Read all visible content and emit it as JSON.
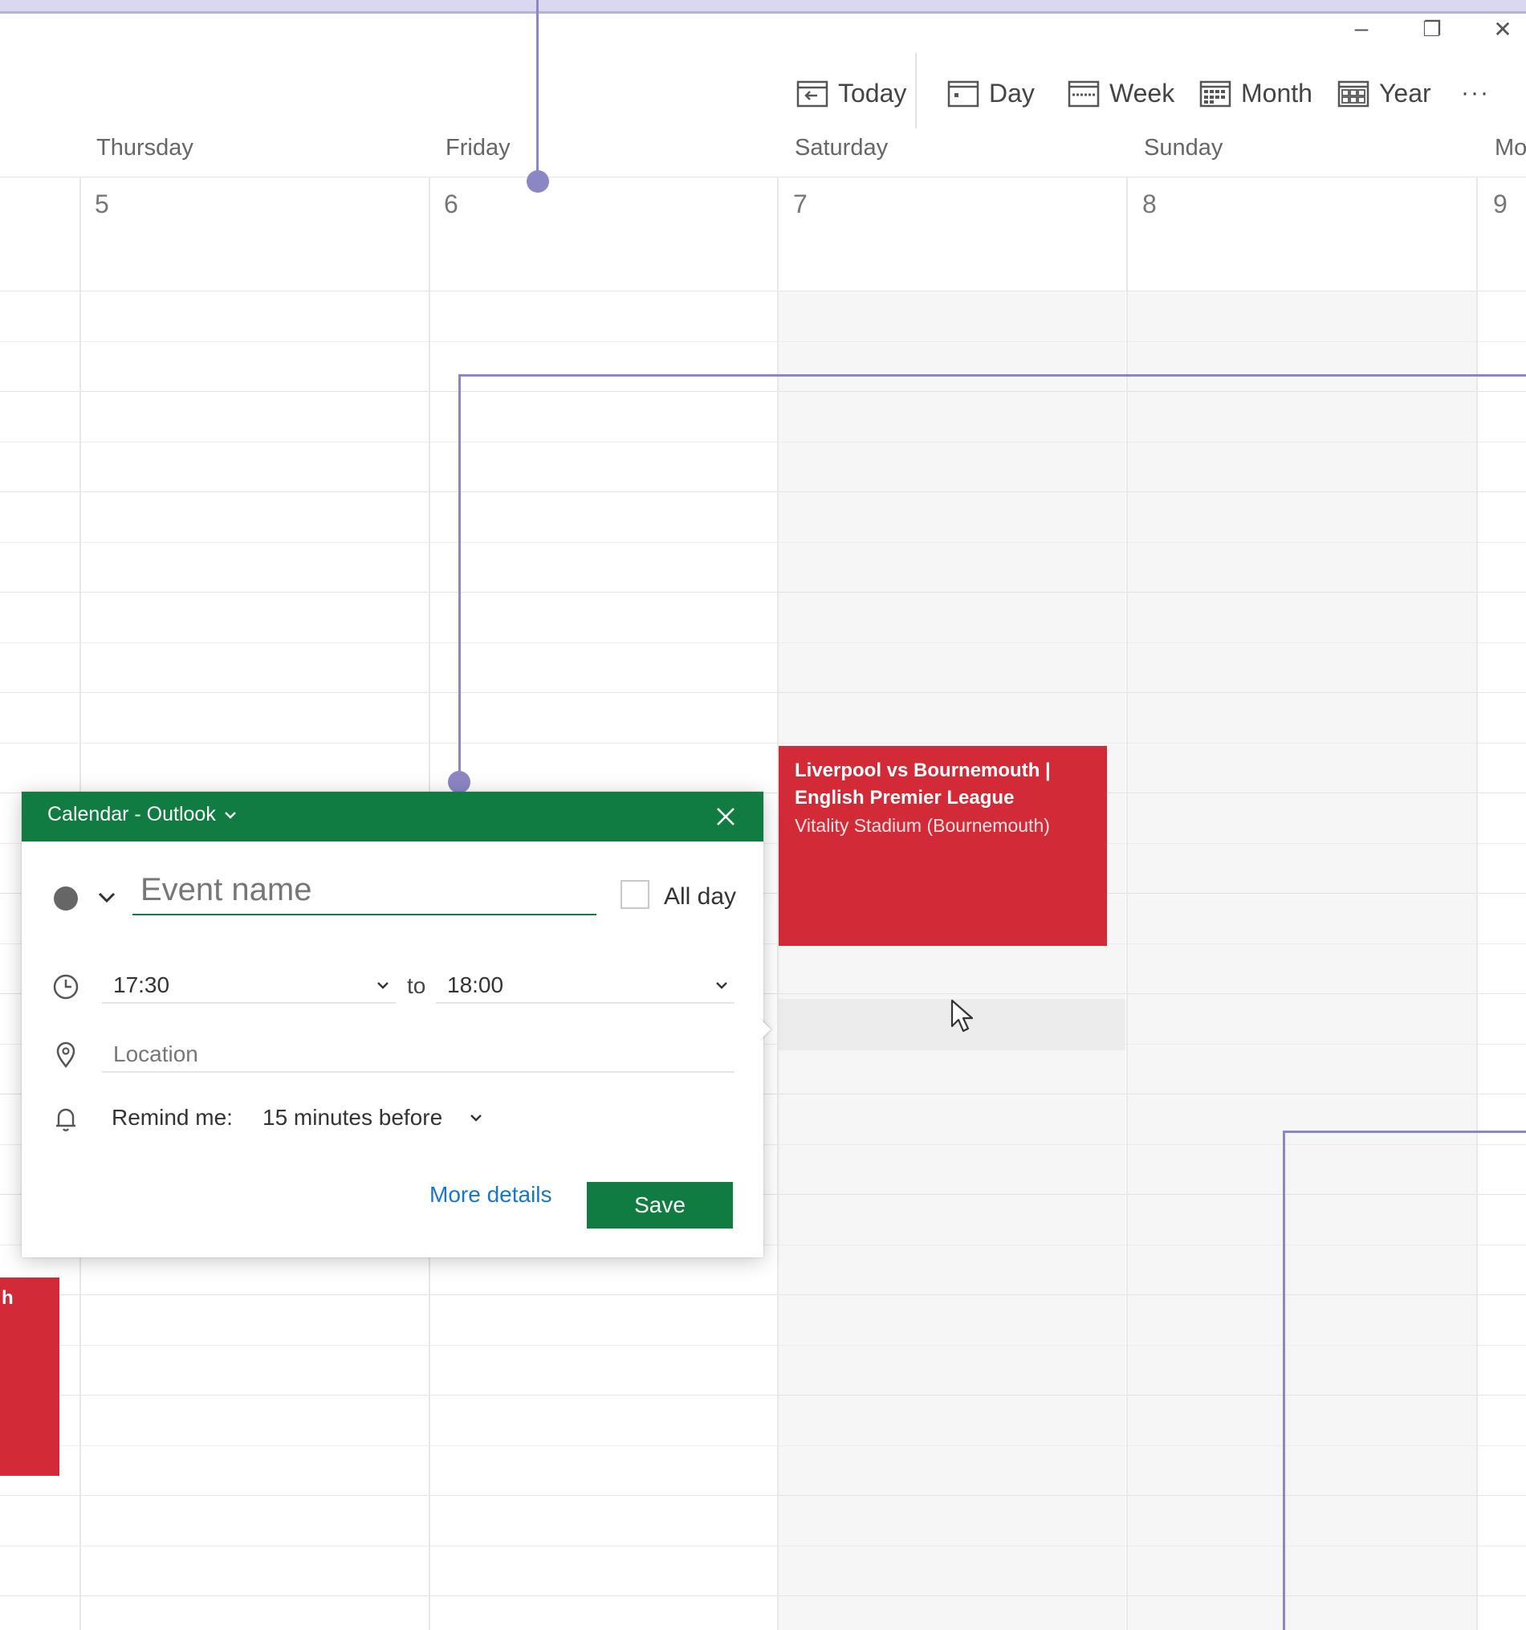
{
  "window": {
    "minimize_glyph": "–",
    "restore_glyph": "❐",
    "close_glyph": "✕"
  },
  "toolbar": {
    "today": "Today",
    "day": "Day",
    "week": "Week",
    "month": "Month",
    "year": "Year",
    "more": "···"
  },
  "days": [
    {
      "name": "Thursday",
      "number": "5"
    },
    {
      "name": "Friday",
      "number": "6"
    },
    {
      "name": "Saturday",
      "number": "7"
    },
    {
      "name": "Sunday",
      "number": "8"
    },
    {
      "name": "Mo",
      "number": "9"
    }
  ],
  "events": {
    "main": {
      "title_line1": "Liverpool vs Bournemouth |",
      "title_line2": "English Premier League",
      "location": "Vitality Stadium (Bournemouth)",
      "color": "#d22b37"
    },
    "left_partial": {
      "title_fragment": "h",
      "color": "#d22b37"
    }
  },
  "popup": {
    "calendar_label": "Calendar - Outlook",
    "event_name_placeholder": "Event name",
    "all_day_label": "All day",
    "start_time": "17:30",
    "to_label": "to",
    "end_time": "18:00",
    "location_placeholder": "Location",
    "remind_label": "Remind me:",
    "remind_value": "15 minutes before",
    "more_details": "More details",
    "save": "Save",
    "header_color": "#107c41"
  },
  "accent": {
    "annotation_color": "#8a87c4"
  }
}
